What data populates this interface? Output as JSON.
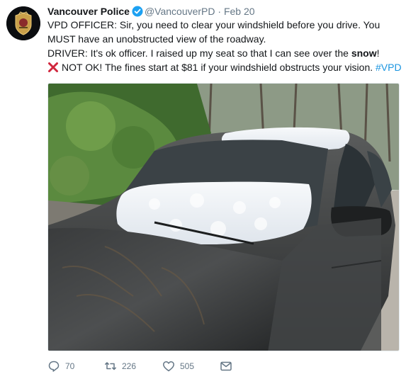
{
  "tweet": {
    "author_name": "Vancouver Police",
    "handle": "@VancouverPD",
    "separator": "·",
    "date": "Feb 20",
    "line1": "VPD OFFICER: Sir, you need to clear your windshield before you drive. You MUST have an unobstructed view of the roadway.",
    "line2_prefix": "DRIVER: It's ok officer. I raised up my seat so that I can see over the ",
    "line2_bold": "snow",
    "line2_suffix": "!",
    "line3_text": "NOT OK! The fines start at $81 if your windshield obstructs your vision. ",
    "hashtag": "#VPD"
  },
  "actions": {
    "replies": "70",
    "retweets": "226",
    "likes": "505"
  },
  "colors": {
    "verified": "#1da1f2",
    "hashtag": "#1b95e0",
    "x_mark": "#d0263d"
  },
  "icons": [
    "vpd-badge-avatar",
    "verified-badge-icon",
    "cross-mark-icon",
    "reply-icon",
    "retweet-icon",
    "like-icon",
    "message-icon"
  ]
}
